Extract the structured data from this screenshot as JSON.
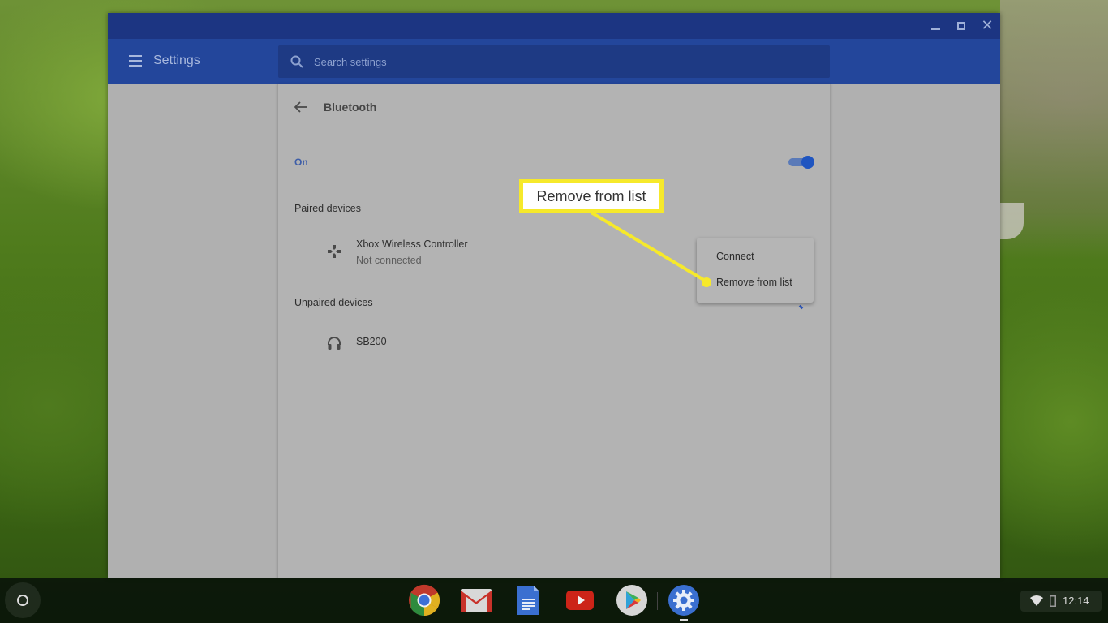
{
  "window": {
    "controls": {
      "minimize_label": "Minimize",
      "maximize_label": "Maximize",
      "close_label": "Close"
    }
  },
  "header": {
    "title": "Settings",
    "search": {
      "placeholder": "Search settings",
      "value": ""
    }
  },
  "page": {
    "title": "Bluetooth",
    "bluetooth_state": "On",
    "bluetooth_enabled": true,
    "paired_section_label": "Paired devices",
    "paired_devices": [
      {
        "name": "Xbox Wireless Controller",
        "status": "Not connected",
        "icon": "gamepad-icon"
      }
    ],
    "unpaired_section_label": "Unpaired devices",
    "unpaired_devices": [
      {
        "name": "SB200",
        "icon": "headphones-icon"
      }
    ]
  },
  "context_menu": {
    "items": [
      {
        "label": "Connect"
      },
      {
        "label": "Remove from list",
        "highlighted": true
      }
    ]
  },
  "annotation": {
    "text": "Remove from list",
    "color": "#f6e92b"
  },
  "shelf": {
    "launcher_icon": "launcher-circle-icon",
    "apps": [
      {
        "name": "Chrome",
        "icon": "chrome-icon"
      },
      {
        "name": "Gmail",
        "icon": "gmail-icon"
      },
      {
        "name": "Google Docs",
        "icon": "docs-icon"
      },
      {
        "name": "YouTube",
        "icon": "youtube-icon"
      },
      {
        "name": "Play Store",
        "icon": "play-store-icon"
      },
      {
        "name": "Settings",
        "icon": "settings-gear-icon",
        "active": true
      }
    ],
    "status": {
      "wifi_icon": "wifi-icon",
      "battery_icon": "battery-icon",
      "time": "12:14"
    }
  },
  "colors": {
    "titlebar": "#1c3582",
    "appbar": "#23469b",
    "search_bg": "#1e3a84",
    "accent": "#1f55c0",
    "overlay_gray": "#b3b3b3"
  }
}
